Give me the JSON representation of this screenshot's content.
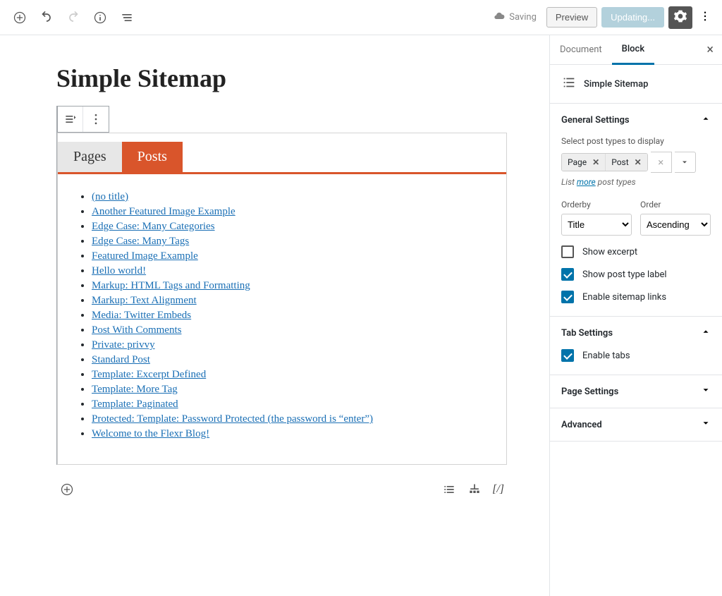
{
  "toolbar": {
    "saving": "Saving",
    "preview": "Preview",
    "update": "Updating..."
  },
  "page": {
    "title": "Simple Sitemap"
  },
  "tabs": {
    "pages": "Pages",
    "posts": "Posts"
  },
  "posts": [
    "(no title)",
    "Another Featured Image Example",
    "Edge Case: Many Categories",
    "Edge Case: Many Tags",
    "Featured Image Example",
    "Hello world!",
    "Markup: HTML Tags and Formatting",
    "Markup: Text Alignment",
    "Media: Twitter Embeds",
    "Post With Comments",
    "Private: privvy",
    "Standard Post",
    "Template: Excerpt Defined",
    "Template: More Tag",
    "Template: Paginated",
    "Protected: Template: Password Protected (the password is “enter”)",
    "Welcome to the Flexr Blog!"
  ],
  "bottom": {
    "shortcode": "[/]"
  },
  "sidebar": {
    "tabs": {
      "document": "Document",
      "block": "Block"
    },
    "block_name": "Simple Sitemap",
    "general": {
      "title": "General Settings",
      "select_pt": "Select post types to display",
      "chips": [
        "Page",
        "Post"
      ],
      "hint_pre": "List ",
      "hint_link": "more",
      "hint_post": " post types",
      "orderby_label": "Orderby",
      "orderby_value": "Title",
      "order_label": "Order",
      "order_value": "Ascending",
      "show_excerpt": "Show excerpt",
      "show_post_type_label": "Show post type label",
      "enable_links": "Enable sitemap links"
    },
    "tabsettings": {
      "title": "Tab Settings",
      "enable_tabs": "Enable tabs"
    },
    "page_settings": "Page Settings",
    "advanced": "Advanced"
  }
}
